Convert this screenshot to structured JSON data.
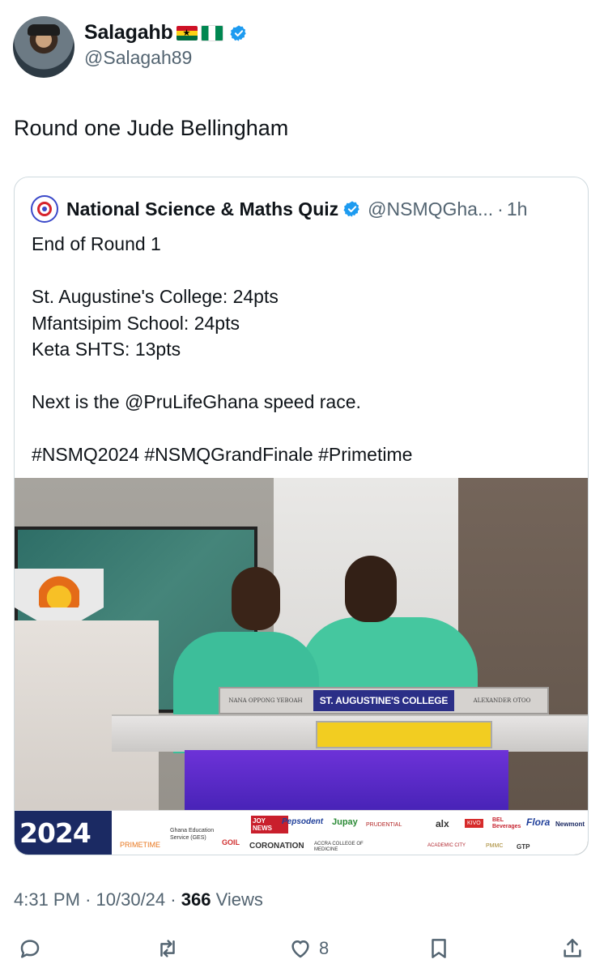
{
  "author": {
    "display_name": "Salagahb",
    "flags": [
      "ghana-flag",
      "nigeria-flag"
    ],
    "verified_icon": "verified-badge-icon",
    "handle": "@Salagah89"
  },
  "tweet": {
    "text": "Round one Jude Bellingham"
  },
  "quoted_tweet": {
    "name": "National Science & Maths Quiz",
    "handle": "@NSMQGha...",
    "separator": "·",
    "time": "1h",
    "lines": [
      "End of Round 1",
      "",
      "St. Augustine's College: 24pts",
      "Mfantsipim School: 24pts",
      "Keta SHTS: 13pts",
      "",
      "Next is the @PruLifeGhana speed race.",
      "",
      "#NSMQ2024 #NSMQGrandFinale #Primetime"
    ],
    "photo": {
      "nameplate_left": "NANA OPPONG YEBOAH",
      "nameplate_school": "ST. AUGUSTINE'S COLLEGE",
      "nameplate_right": "ALEXANDER OTOO",
      "banner_year": "2024",
      "banner_sponsors": {
        "primetime": "PRIMETIME",
        "ges": "Ghana Education Service (GES)",
        "goil": "GOIL",
        "joy_news": "JOY NEWS",
        "coronation": "CORONATION",
        "pepsodent": "Pepsodent",
        "jupay": "Jupay",
        "prudential": "PRUDENTIAL",
        "accra_medicine": "ACCRA COLLEGE OF MEDICINE",
        "alx": "alx",
        "kivo": "KIVO",
        "academic_city": "ACADEMIC CITY",
        "pmmc": "PMMC",
        "bel": "BEL Beverages",
        "flora": "Flora",
        "gtp": "GTP",
        "newmont": "Newmont"
      }
    }
  },
  "meta": {
    "time": "4:31 PM",
    "dot1": "·",
    "date": "10/30/24",
    "dot2": "·",
    "views_count": "366",
    "views_label": "Views"
  },
  "actions": {
    "reply_icon": "reply-icon",
    "retweet_icon": "retweet-icon",
    "like_icon": "heart-icon",
    "like_count": "8",
    "bookmark_icon": "bookmark-icon",
    "share_icon": "share-icon"
  },
  "colors": {
    "verified": "#1d9bf0",
    "secondary_text": "#536471",
    "primary_text": "#0f1419",
    "border": "#cfd9de"
  }
}
